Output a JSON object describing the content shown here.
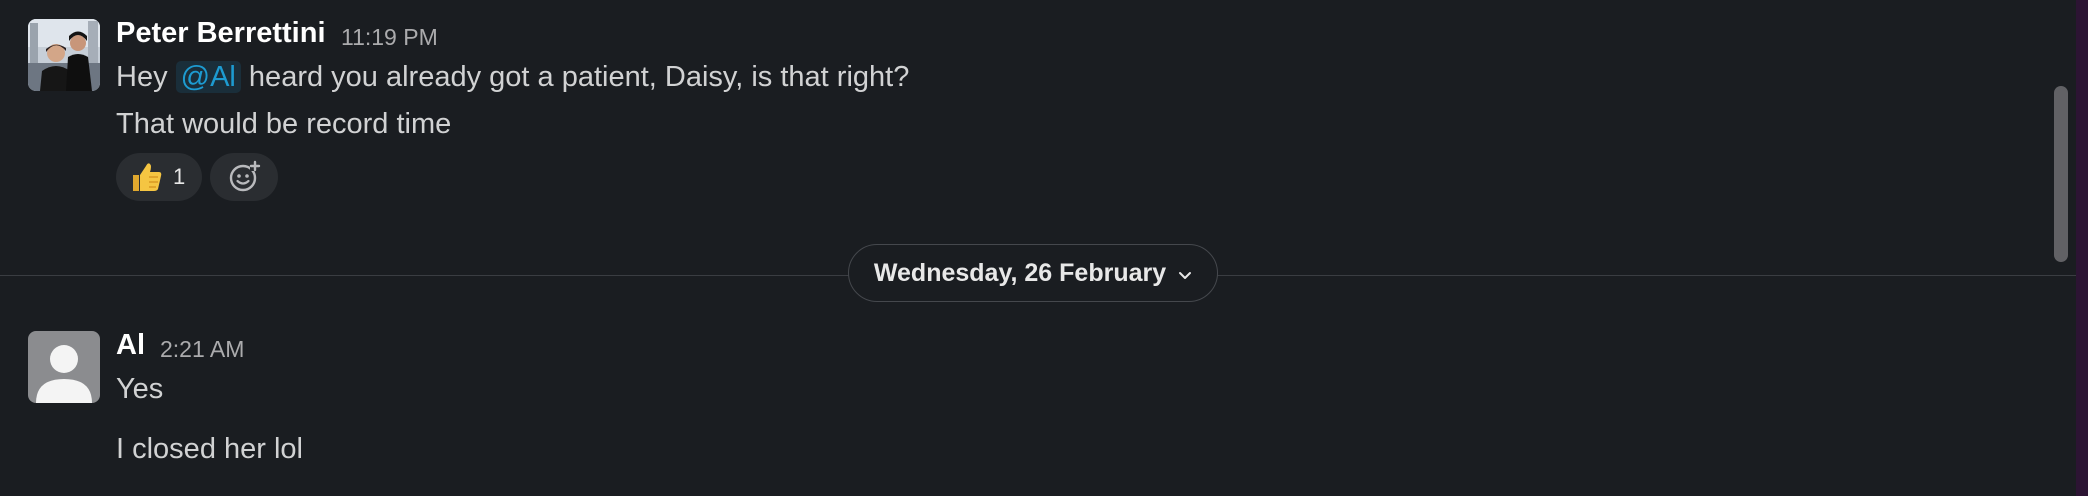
{
  "messages": [
    {
      "sender": "Peter Berrettini",
      "time": "11:19 PM",
      "avatar_icon": "photo-avatar",
      "line1": {
        "before": "Hey ",
        "mention": "@Al",
        "after": " heard you already got a patient, Daisy, is that right?"
      },
      "line2": "That would be record time",
      "reactions": [
        {
          "emoji": "thumbs-up-icon",
          "count": "1"
        }
      ],
      "add_reaction_icon": "add-reaction-icon"
    },
    {
      "sender": "Al",
      "time": "2:21 AM",
      "avatar_icon": "default-user-avatar",
      "line1": "Yes",
      "line2": "I closed her lol"
    }
  ],
  "date_divider": {
    "label": "Wednesday, 26 February",
    "icon": "chevron-down-icon"
  },
  "colors": {
    "background": "#1a1d21",
    "mention": "#1d9bd1",
    "scroll_track": "#2c1433"
  }
}
